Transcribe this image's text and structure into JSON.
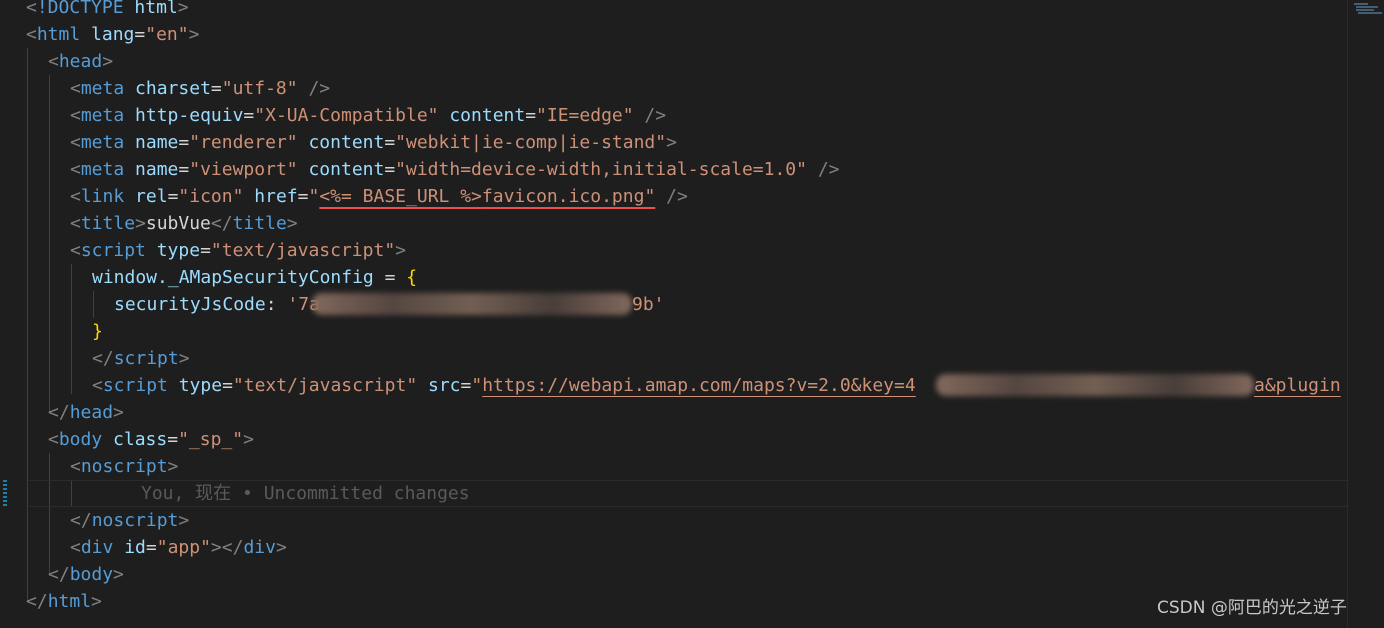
{
  "code": {
    "l1": {
      "open": "<",
      "doctype": "!DOCTYPE",
      "html": "html",
      "close": ">"
    },
    "l2": {
      "lt": "<",
      "tag": "html",
      "attr": "lang",
      "eq": "=",
      "val": "\"en\"",
      "gt": ">"
    },
    "l3": {
      "lt": "<",
      "tag": "head",
      "gt": ">"
    },
    "l4": {
      "lt": "<",
      "tag": "meta",
      "attr": "charset",
      "eq": "=",
      "val": "\"utf-8\"",
      "end": " />"
    },
    "l5": {
      "lt": "<",
      "tag": "meta",
      "attr1": "http-equiv",
      "val1": "\"X-UA-Compatible\"",
      "attr2": "content",
      "val2": "\"IE=edge\"",
      "end": " />"
    },
    "l6": {
      "lt": "<",
      "tag": "meta",
      "attr1": "name",
      "val1": "\"renderer\"",
      "attr2": "content",
      "val2": "\"webkit|ie-comp|ie-stand\"",
      "end": ">"
    },
    "l7": {
      "lt": "<",
      "tag": "meta",
      "attr1": "name",
      "val1": "\"viewport\"",
      "attr2": "content",
      "val2": "\"width=device-width,initial-scale=1.0\"",
      "end": " />"
    },
    "l8": {
      "lt": "<",
      "tag": "link",
      "attr1": "rel",
      "val1": "\"icon\"",
      "attr2": "href",
      "q": "\"",
      "val2a": "<%= BASE_URL %>",
      "val2b": "favicon.ico.png\"",
      "end": " />"
    },
    "l9": {
      "lt": "<",
      "tag": "title",
      "gt": ">",
      "text": "subVue",
      "lt2": "</",
      "tag2": "title",
      "gt2": ">"
    },
    "l10": {
      "lt": "<",
      "tag": "script",
      "attr": "type",
      "val": "\"text/javascript\"",
      "gt": ">"
    },
    "l11": {
      "obj": "window._AMapSecurityConfig",
      "op": " = ",
      "brace": "{"
    },
    "l12": {
      "prop": "securityJsCode",
      "colon": ": ",
      "str": "'7a",
      "strEnd": "9b'"
    },
    "l13": {
      "brace": "}"
    },
    "l14": {
      "lt": "</",
      "tag": "script",
      "gt": ">"
    },
    "l15": {
      "lt": "<",
      "tag": "script",
      "attr1": "type",
      "val1": "\"text/javascript\"",
      "attr2": "src",
      "url": "https://webapi.amap.com/maps?v=2.0&key=4",
      "urlEnd": "a&plugin"
    },
    "l16": {
      "lt": "</",
      "tag": "head",
      "gt": ">"
    },
    "l17": {
      "lt": "<",
      "tag": "body",
      "attr": "class",
      "val": "\"_sp_\"",
      "gt": ">"
    },
    "l18": {
      "lt": "<",
      "tag": "noscript",
      "gt": ">"
    },
    "l19": {
      "blame": "You, 现在 • Uncommitted changes"
    },
    "l20": {
      "lt": "</",
      "tag": "noscript",
      "gt": ">"
    },
    "l21": {
      "lt": "<",
      "tag": "div",
      "attr": "id",
      "val": "\"app\"",
      "gt": ">",
      "lt2": "</",
      "tag2": "div",
      "gt2": ">"
    },
    "l22": {
      "lt": "</",
      "tag": "body",
      "gt": ">"
    },
    "l23": {
      "lt": "</",
      "tag": "html",
      "gt": ">"
    }
  },
  "watermark": "CSDN @阿巴的光之逆子",
  "colors": {
    "background": "#1e1e1e",
    "tag": "#569cd6",
    "attribute": "#9cdcfe",
    "string": "#ce9178",
    "bracket": "#808080",
    "brace": "#ffd700",
    "error_underline": "#f14c4c",
    "blame": "#5a5a5a"
  }
}
